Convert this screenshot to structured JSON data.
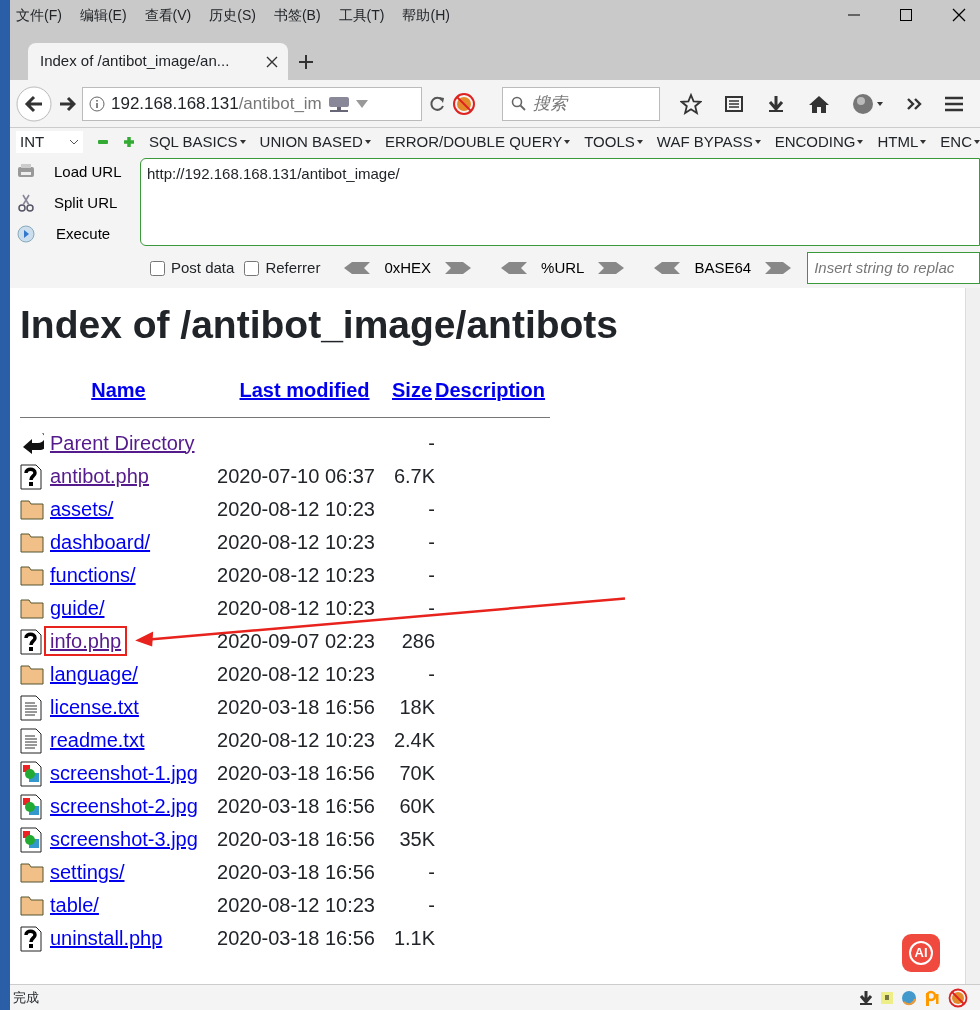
{
  "menu": [
    "文件(F)",
    "编辑(E)",
    "查看(V)",
    "历史(S)",
    "书签(B)",
    "工具(T)",
    "帮助(H)"
  ],
  "tabs": [
    {
      "label": "Index of /antibot_image/an...",
      "selected": true
    }
  ],
  "address": {
    "host": "192.168.168.131",
    "path": "/antibot_im"
  },
  "search": {
    "placeholder": "搜索"
  },
  "hackbar": {
    "select": "INT",
    "menus": [
      "SQL BASICS",
      "UNION BASED",
      "ERROR/DOUBLE QUERY",
      "TOOLS",
      "WAF BYPASS",
      "ENCODING",
      "HTML",
      "ENC"
    ],
    "actions": [
      {
        "kind": "load",
        "label": "Load URL"
      },
      {
        "kind": "split",
        "label": "Split URL"
      },
      {
        "kind": "execute",
        "label": "Execute"
      }
    ],
    "url": "http://192.168.168.131/antibot_image/",
    "options": [
      {
        "label": "Post data",
        "checked": false
      },
      {
        "label": "Referrer",
        "checked": false
      }
    ],
    "encoders": [
      "0xHEX",
      "%URL",
      "BASE64"
    ],
    "replace": {
      "placeholder": "Insert string to replac"
    }
  },
  "page": {
    "title": "Index of /antibot_image/antibots",
    "columns": [
      "Name",
      "Last modified",
      "Size",
      "Description"
    ],
    "rows": [
      {
        "kind": "back",
        "name": "Parent Directory",
        "modified": "",
        "size": "-",
        "visited": true,
        "highlighted": false
      },
      {
        "kind": "unknown",
        "name": "antibot.php",
        "modified": "2020-07-10 06:37",
        "size": "6.7K",
        "visited": true,
        "highlighted": false
      },
      {
        "kind": "folder",
        "name": "assets/",
        "modified": "2020-08-12 10:23",
        "size": "-",
        "visited": false,
        "highlighted": false
      },
      {
        "kind": "folder",
        "name": "dashboard/",
        "modified": "2020-08-12 10:23",
        "size": "-",
        "visited": false,
        "highlighted": false
      },
      {
        "kind": "folder",
        "name": "functions/",
        "modified": "2020-08-12 10:23",
        "size": "-",
        "visited": false,
        "highlighted": false
      },
      {
        "kind": "folder",
        "name": "guide/",
        "modified": "2020-08-12 10:23",
        "size": "-",
        "visited": false,
        "highlighted": false
      },
      {
        "kind": "unknown",
        "name": "info.php",
        "modified": "2020-09-07 02:23",
        "size": "286",
        "visited": true,
        "highlighted": true
      },
      {
        "kind": "folder",
        "name": "language/",
        "modified": "2020-08-12 10:23",
        "size": "-",
        "visited": false,
        "highlighted": false
      },
      {
        "kind": "text",
        "name": "license.txt",
        "modified": "2020-03-18 16:56",
        "size": "18K",
        "visited": false,
        "highlighted": false
      },
      {
        "kind": "text",
        "name": "readme.txt",
        "modified": "2020-08-12 10:23",
        "size": "2.4K",
        "visited": false,
        "highlighted": false
      },
      {
        "kind": "image",
        "name": "screenshot-1.jpg",
        "modified": "2020-03-18 16:56",
        "size": "70K",
        "visited": false,
        "highlighted": false
      },
      {
        "kind": "image",
        "name": "screenshot-2.jpg",
        "modified": "2020-03-18 16:56",
        "size": "60K",
        "visited": false,
        "highlighted": false
      },
      {
        "kind": "image",
        "name": "screenshot-3.jpg",
        "modified": "2020-03-18 16:56",
        "size": "35K",
        "visited": false,
        "highlighted": false
      },
      {
        "kind": "folder",
        "name": "settings/",
        "modified": "2020-03-18 16:56",
        "size": "-",
        "visited": false,
        "highlighted": false
      },
      {
        "kind": "folder",
        "name": "table/",
        "modified": "2020-08-12 10:23",
        "size": "-",
        "visited": false,
        "highlighted": false
      },
      {
        "kind": "unknown",
        "name": "uninstall.php",
        "modified": "2020-03-18 16:56",
        "size": "1.1K",
        "visited": false,
        "highlighted": false
      }
    ]
  },
  "ai_button": "AI",
  "status_bar": "完成"
}
